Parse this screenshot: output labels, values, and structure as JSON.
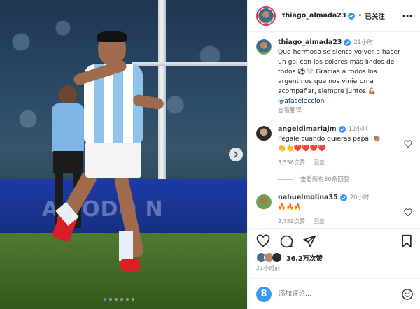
{
  "post": {
    "author": "thiago_almada23",
    "follow_state": "已关注",
    "caption_time": "21小时",
    "caption": "Que hermoso se siente volver a hacer un gol con los colores más lindos de todos ⚽️🤍 Gracias a todos los argentinos que nos vinieron a acompañar, siempre juntos 💪🏽",
    "caption_mention": "@afaseleccion",
    "translate_label": "查看翻译",
    "likes": "36.2万次赞",
    "posted_ago": "21小时前"
  },
  "comments": [
    {
      "user": "angeldimariajm",
      "time": "12小时",
      "text": "Pégale cuando quieras papá. 👏🏽",
      "emoji_line": "👏👏❤️❤️❤️❤️",
      "likes": "3,556次赞",
      "reply": "回复"
    },
    {
      "user": "nahuelmolina35",
      "time": "20小时",
      "text": "🔥🔥🔥",
      "likes": "2,759次赞",
      "reply": "回复"
    }
  ],
  "view_replies": "查看所有30条回复",
  "add_comment": {
    "placeholder": "添加评论...",
    "avatar_letter": "8"
  },
  "photo": {
    "ad_text": "A TODO N"
  },
  "colors": {
    "verified": "#3897f0",
    "heart_red": "#ed4956",
    "mention": "#00376b"
  }
}
